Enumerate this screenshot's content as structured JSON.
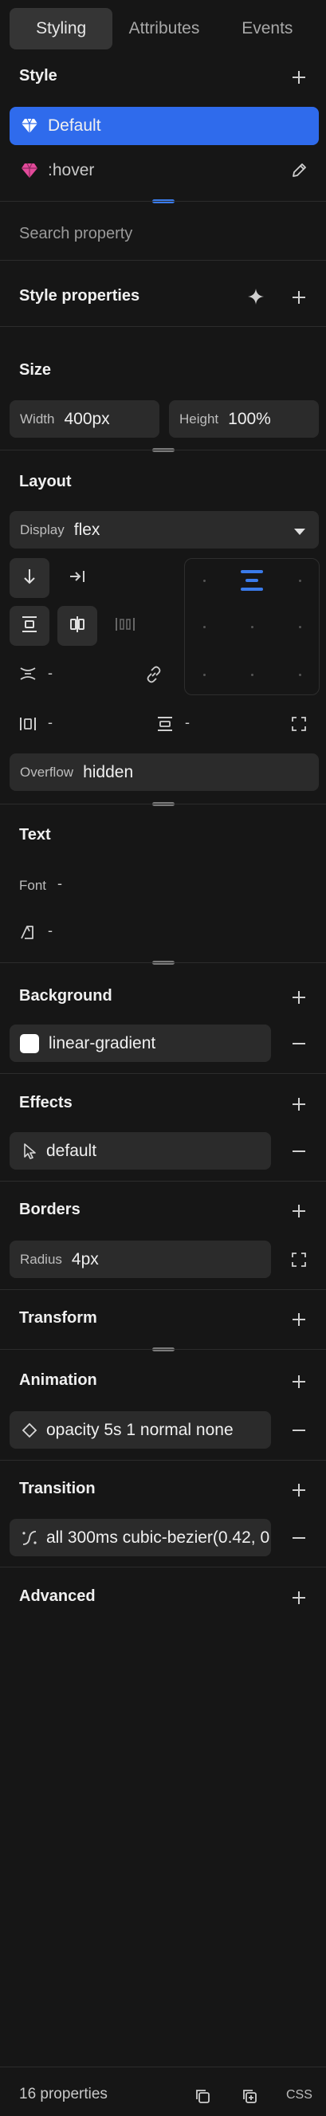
{
  "tabs": [
    "Styling",
    "Attributes",
    "Events"
  ],
  "style": {
    "title": "Style",
    "items": [
      {
        "label": "Default",
        "active": true
      },
      {
        "label": ":hover",
        "active": false
      }
    ]
  },
  "search": {
    "placeholder": "Search property"
  },
  "style_properties": {
    "title": "Style properties"
  },
  "size": {
    "title": "Size",
    "width_label": "Width",
    "width_value": "400px",
    "height_label": "Height",
    "height_value": "100%"
  },
  "layout": {
    "title": "Layout",
    "display_label": "Display",
    "display_value": "flex",
    "gap_value": "-",
    "padding_value": "-",
    "margin_value": "-",
    "overflow_label": "Overflow",
    "overflow_value": "hidden"
  },
  "text": {
    "title": "Text",
    "font_label": "Font",
    "font_value": "-",
    "style_value": "-"
  },
  "background": {
    "title": "Background",
    "value": "linear-gradient"
  },
  "effects": {
    "title": "Effects",
    "value": "default"
  },
  "borders": {
    "title": "Borders",
    "radius_label": "Radius",
    "radius_value": "4px"
  },
  "transform": {
    "title": "Transform"
  },
  "animation": {
    "title": "Animation",
    "value": "opacity 5s 1 normal none"
  },
  "transition": {
    "title": "Transition",
    "value": "all 300ms cubic-bezier(0.42, 0"
  },
  "advanced": {
    "title": "Advanced"
  },
  "footer": {
    "count": "16 properties",
    "css_label": "CSS"
  },
  "colors": {
    "accent": "#2f6bec",
    "hover_gem": "#e24a9a",
    "bg": "#161616",
    "field": "#2b2b2b"
  }
}
